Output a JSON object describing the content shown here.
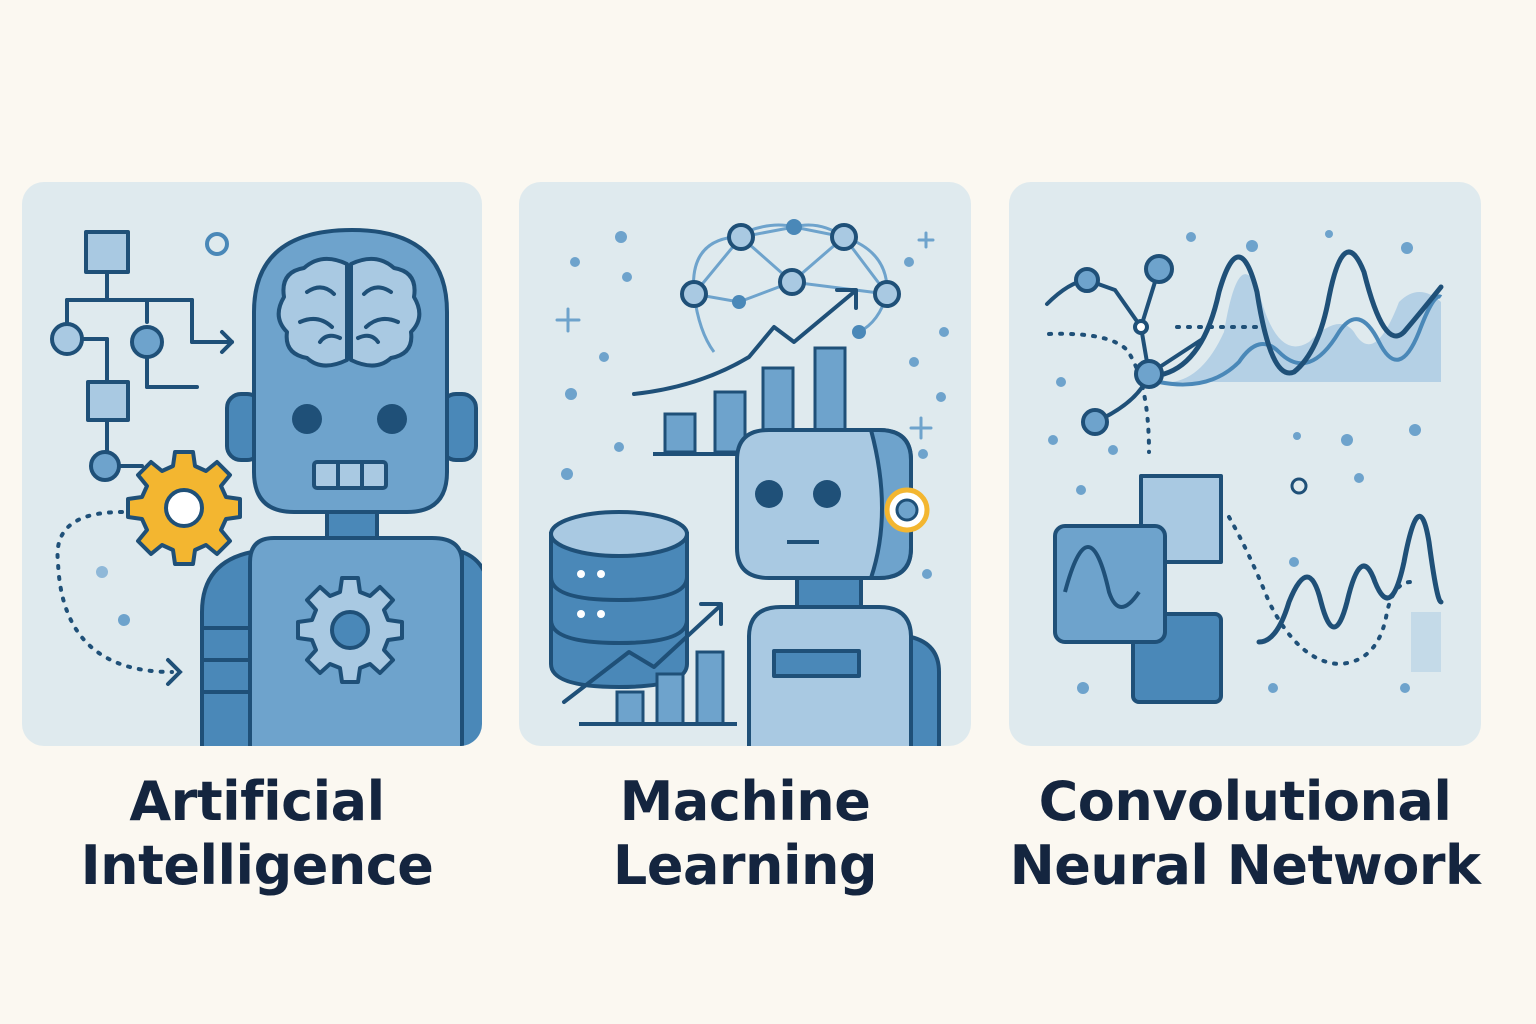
{
  "panels": [
    {
      "line1": "Artificial",
      "line2": "Intelligence"
    },
    {
      "line1": "Machine",
      "line2": "Learning"
    },
    {
      "line1": "Convolutional",
      "line2": "Neural Network"
    }
  ],
  "colors": {
    "background": "#fbf8f1",
    "card": "#dfeaee",
    "outline": "#1f5078",
    "fill_light": "#a9c9e2",
    "fill_mid": "#6ea3cc",
    "fill_dark": "#4a88b8",
    "accent_yellow": "#f3b630",
    "text": "#14253f"
  },
  "icons": [
    "flowchart-icon",
    "robot-icon",
    "brain-icon",
    "gear-icon",
    "bar-chart-icon",
    "database-icon",
    "trend-arrow-icon",
    "neural-network-icon",
    "wave-icon",
    "feature-map-icon"
  ]
}
